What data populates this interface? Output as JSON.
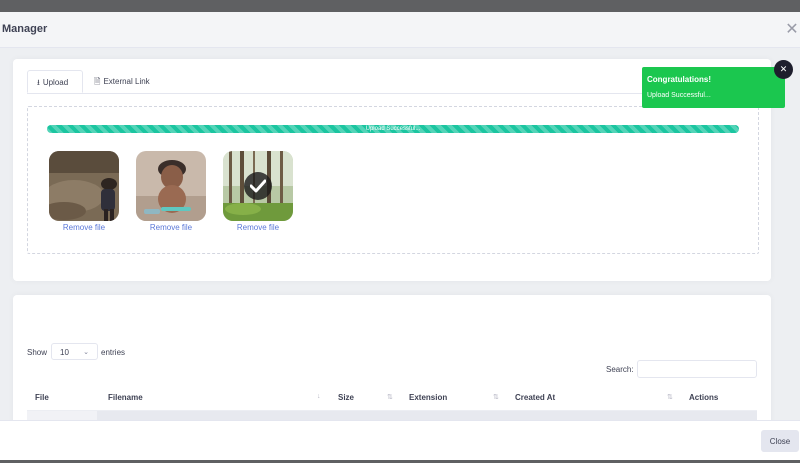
{
  "modal": {
    "title": "Manager",
    "close_icon": "close-icon"
  },
  "tabs": [
    {
      "label": "Upload",
      "icon": "upload-icon",
      "active": true
    },
    {
      "label": "External Link",
      "icon": "file-icon",
      "active": false
    }
  ],
  "upload": {
    "progress_text": "Upload Successful...",
    "progress_percent": 100,
    "files": [
      {
        "remove_label": "Remove file",
        "status": "uploaded"
      },
      {
        "remove_label": "Remove file",
        "status": "uploaded"
      },
      {
        "remove_label": "Remove file",
        "status": "success",
        "overlay_icon": "check-icon"
      }
    ]
  },
  "table": {
    "show_label": "Show",
    "entries_value": "10",
    "entries_label": "entries",
    "search_label": "Search:",
    "search_value": "",
    "columns": [
      "File",
      "Filename",
      "Size",
      "Extension",
      "Created At",
      "Actions"
    ]
  },
  "footer": {
    "close_label": "Close"
  },
  "toast": {
    "title": "Congratulations!",
    "message": "Upload Successful...",
    "color": "#1bc74f"
  },
  "colors": {
    "accent": "#1bc5a0",
    "link": "#5b78d8"
  }
}
